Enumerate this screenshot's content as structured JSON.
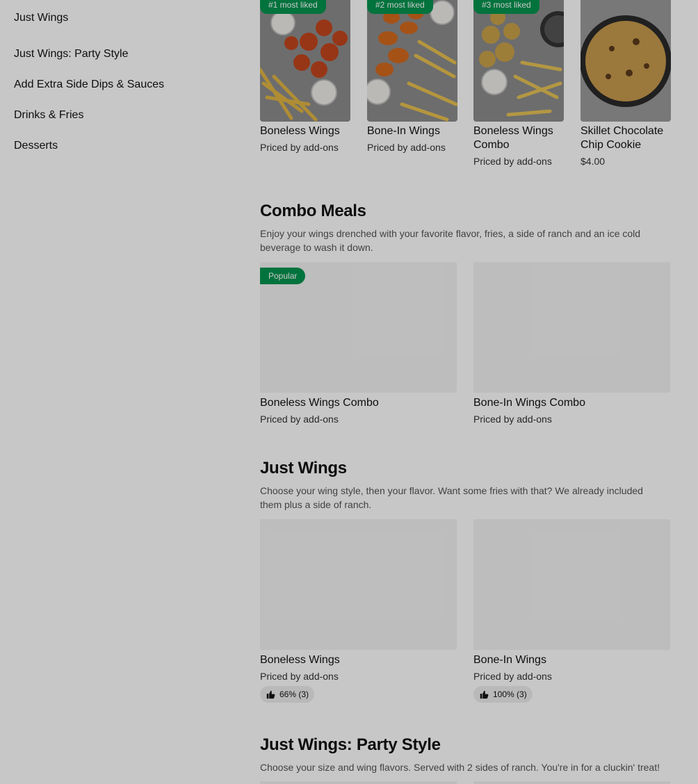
{
  "sidebar": {
    "items": [
      {
        "label": "Just Wings"
      },
      {
        "label": "Just Wings: Party Style"
      },
      {
        "label": "Add Extra Side Dips & Sauces"
      },
      {
        "label": "Drinks & Fries"
      },
      {
        "label": "Desserts"
      }
    ]
  },
  "top_picks": [
    {
      "badge": "#1 most liked",
      "name": "Boneless Wings",
      "price": "Priced by add-ons"
    },
    {
      "badge": "#2 most liked",
      "name": "Bone-In Wings",
      "price": "Priced by add-ons"
    },
    {
      "badge": "#3 most liked",
      "name": "Boneless Wings Combo",
      "price": "Priced by add-ons"
    },
    {
      "badge": "",
      "name": "Skillet Chocolate Chip Cookie",
      "price": "$4.00"
    }
  ],
  "sections": [
    {
      "title": "Combo Meals",
      "description": "Enjoy your wings drenched with your favorite flavor, fries, a side of ranch and an ice cold beverage to wash it down.",
      "items": [
        {
          "badge": "Popular",
          "name": "Boneless Wings Combo",
          "price": "Priced by add-ons",
          "rating": ""
        },
        {
          "badge": "",
          "name": "Bone-In Wings Combo",
          "price": "Priced by add-ons",
          "rating": ""
        }
      ]
    },
    {
      "title": "Just Wings",
      "description": "Choose your wing style, then your flavor. Want some fries with that? We already included them plus a side of ranch.",
      "items": [
        {
          "badge": "",
          "name": "Boneless Wings",
          "price": "Priced by add-ons",
          "rating": "66% (3)"
        },
        {
          "badge": "",
          "name": "Bone-In Wings",
          "price": "Priced by add-ons",
          "rating": "100% (3)"
        }
      ]
    },
    {
      "title": "Just Wings: Party Style",
      "description": "Choose your size and wing flavors. Served with 2 sides of ranch. You're in for a cluckin' treat!"
    }
  ],
  "colors": {
    "accent_green": "#05944f",
    "placeholder_gray": "#f3f3f3",
    "overlay": "rgba(0,0,0,0.22)"
  }
}
